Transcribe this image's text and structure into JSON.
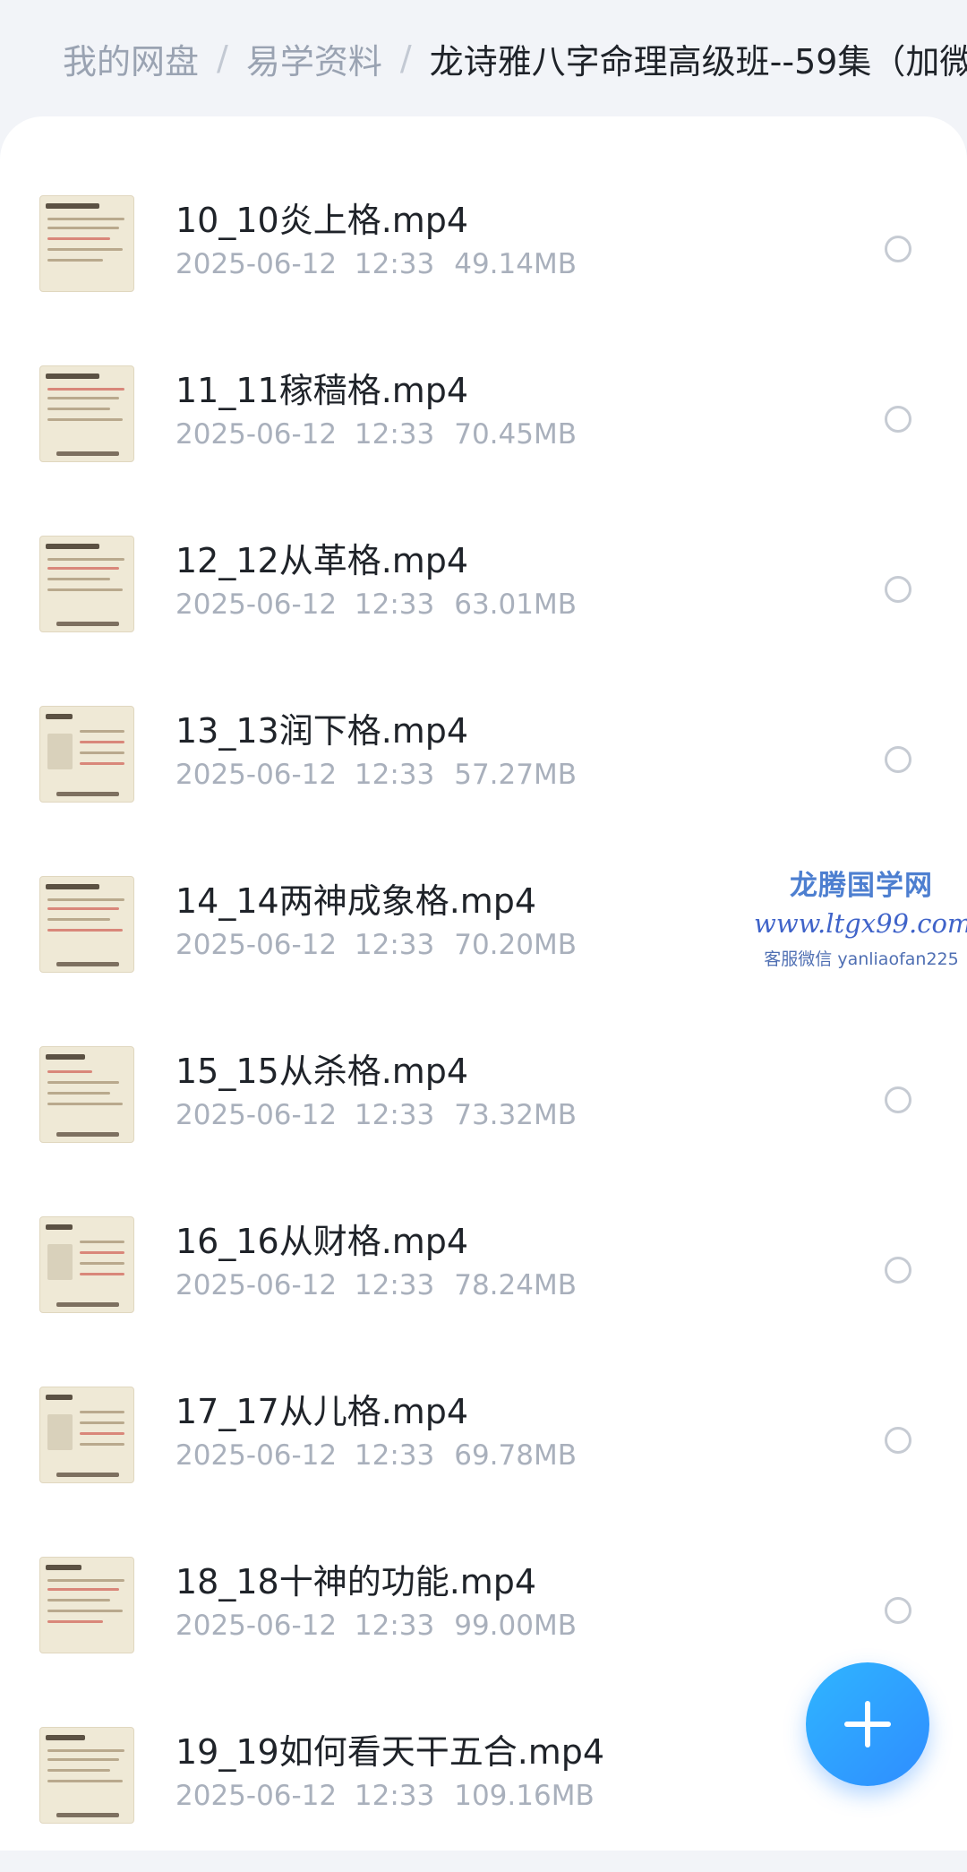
{
  "breadcrumb": {
    "root": "我的网盘",
    "folder": "易学资料",
    "current": "龙诗雅八字命理高级班--59集（加微"
  },
  "files": [
    {
      "name": "10_10炎上格.mp4",
      "date": "2025-06-12",
      "time": "12:33",
      "size": "49.14MB"
    },
    {
      "name": "11_11稼穑格.mp4",
      "date": "2025-06-12",
      "time": "12:33",
      "size": "70.45MB"
    },
    {
      "name": "12_12从革格.mp4",
      "date": "2025-06-12",
      "time": "12:33",
      "size": "63.01MB"
    },
    {
      "name": "13_13润下格.mp4",
      "date": "2025-06-12",
      "time": "12:33",
      "size": "57.27MB"
    },
    {
      "name": "14_14两神成象格.mp4",
      "date": "2025-06-12",
      "time": "12:33",
      "size": "70.20MB"
    },
    {
      "name": "15_15从杀格.mp4",
      "date": "2025-06-12",
      "time": "12:33",
      "size": "73.32MB"
    },
    {
      "name": "16_16从财格.mp4",
      "date": "2025-06-12",
      "time": "12:33",
      "size": "78.24MB"
    },
    {
      "name": "17_17从儿格.mp4",
      "date": "2025-06-12",
      "time": "12:33",
      "size": "69.78MB"
    },
    {
      "name": "18_18十神的功能.mp4",
      "date": "2025-06-12",
      "time": "12:33",
      "size": "99.00MB"
    },
    {
      "name": "19_19如何看天干五合.mp4",
      "date": "2025-06-12",
      "time": "12:33",
      "size": "109.16MB"
    }
  ],
  "watermark": {
    "title": "龙腾国学网",
    "url": "www.ltgx99.com",
    "wechat": "客服微信 yanliaofan225"
  },
  "icons": {
    "fab": "plus-icon",
    "row_select": "radio-icon"
  },
  "colors": {
    "accent": "#2f8dff",
    "text_primary": "#1f2329",
    "text_secondary": "#a9b0bc"
  }
}
